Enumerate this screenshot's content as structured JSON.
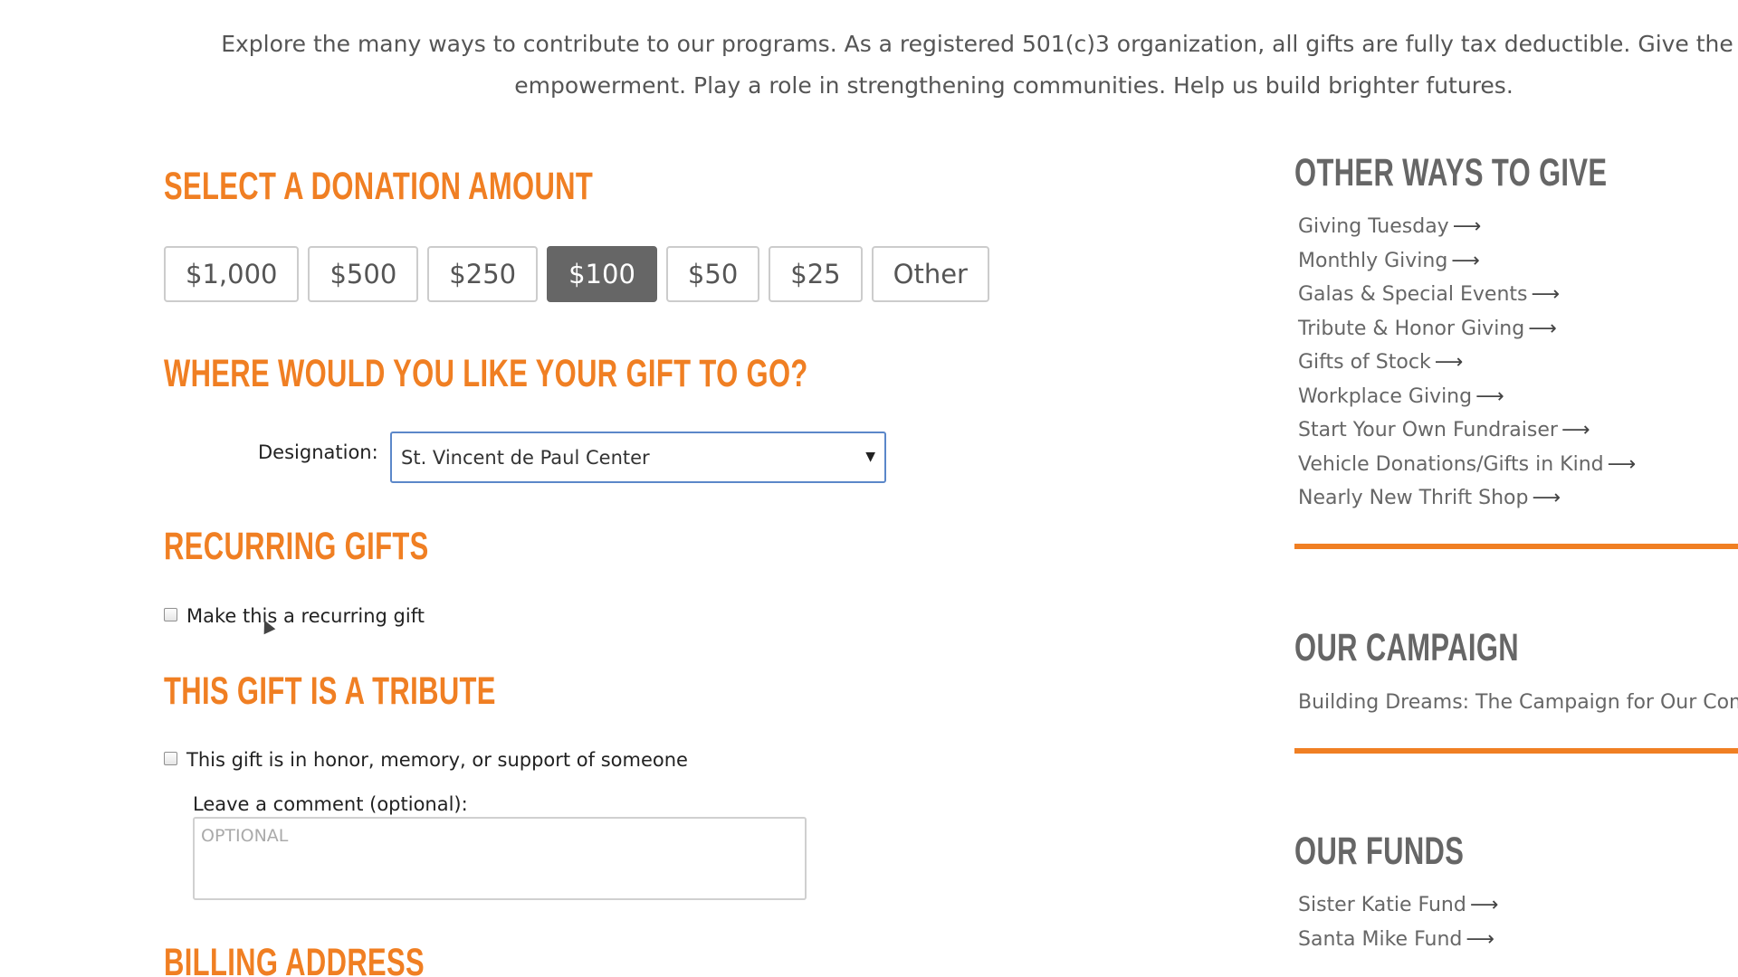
{
  "intro": {
    "line1": "Explore the many ways to contribute to our programs. As a registered 501(c)3 organization, all gifts are fully tax deductible. Give the gift of",
    "line2": "empowerment. Play a role in strengthening communities. Help us build brighter futures."
  },
  "donation": {
    "heading": "Select a Donation Amount",
    "amounts": [
      "$1,000",
      "$500",
      "$250",
      "$100",
      "$50",
      "$25",
      "Other"
    ],
    "selected": "$100"
  },
  "designation": {
    "heading": "Where would you like your gift to go?",
    "label": "Designation:",
    "value": "St. Vincent de Paul Center"
  },
  "recurring": {
    "heading": "Recurring Gifts",
    "checkbox_label": "Make this a recurring gift",
    "checked": false
  },
  "tribute": {
    "heading": "This Gift Is a Tribute",
    "checkbox_label": "This gift is in honor, memory, or support of someone",
    "checked": false,
    "comment_label": "Leave a comment (optional):",
    "comment_placeholder": "OPTIONAL"
  },
  "billing": {
    "heading": "Billing Address"
  },
  "sidebar": {
    "other_ways": {
      "heading": "Other Ways to Give",
      "items": [
        "Giving Tuesday",
        "Monthly Giving",
        "Galas & Special Events",
        "Tribute & Honor Giving",
        "Gifts of Stock",
        "Workplace Giving",
        "Start Your Own Fundraiser",
        "Vehicle Donations/Gifts in Kind",
        "Nearly New Thrift Shop"
      ]
    },
    "campaign": {
      "heading": "Our Campaign",
      "text": "Building Dreams: The Campaign for Our Commu"
    },
    "funds": {
      "heading": "Our Funds",
      "items": [
        "Sister Katie Fund",
        "Santa Mike Fund"
      ]
    },
    "link_arrow": "⟶"
  },
  "colors": {
    "accent": "#f07f23",
    "heading_gray": "#666666",
    "selected_button": "#666666",
    "select_border": "#5b87c9"
  }
}
